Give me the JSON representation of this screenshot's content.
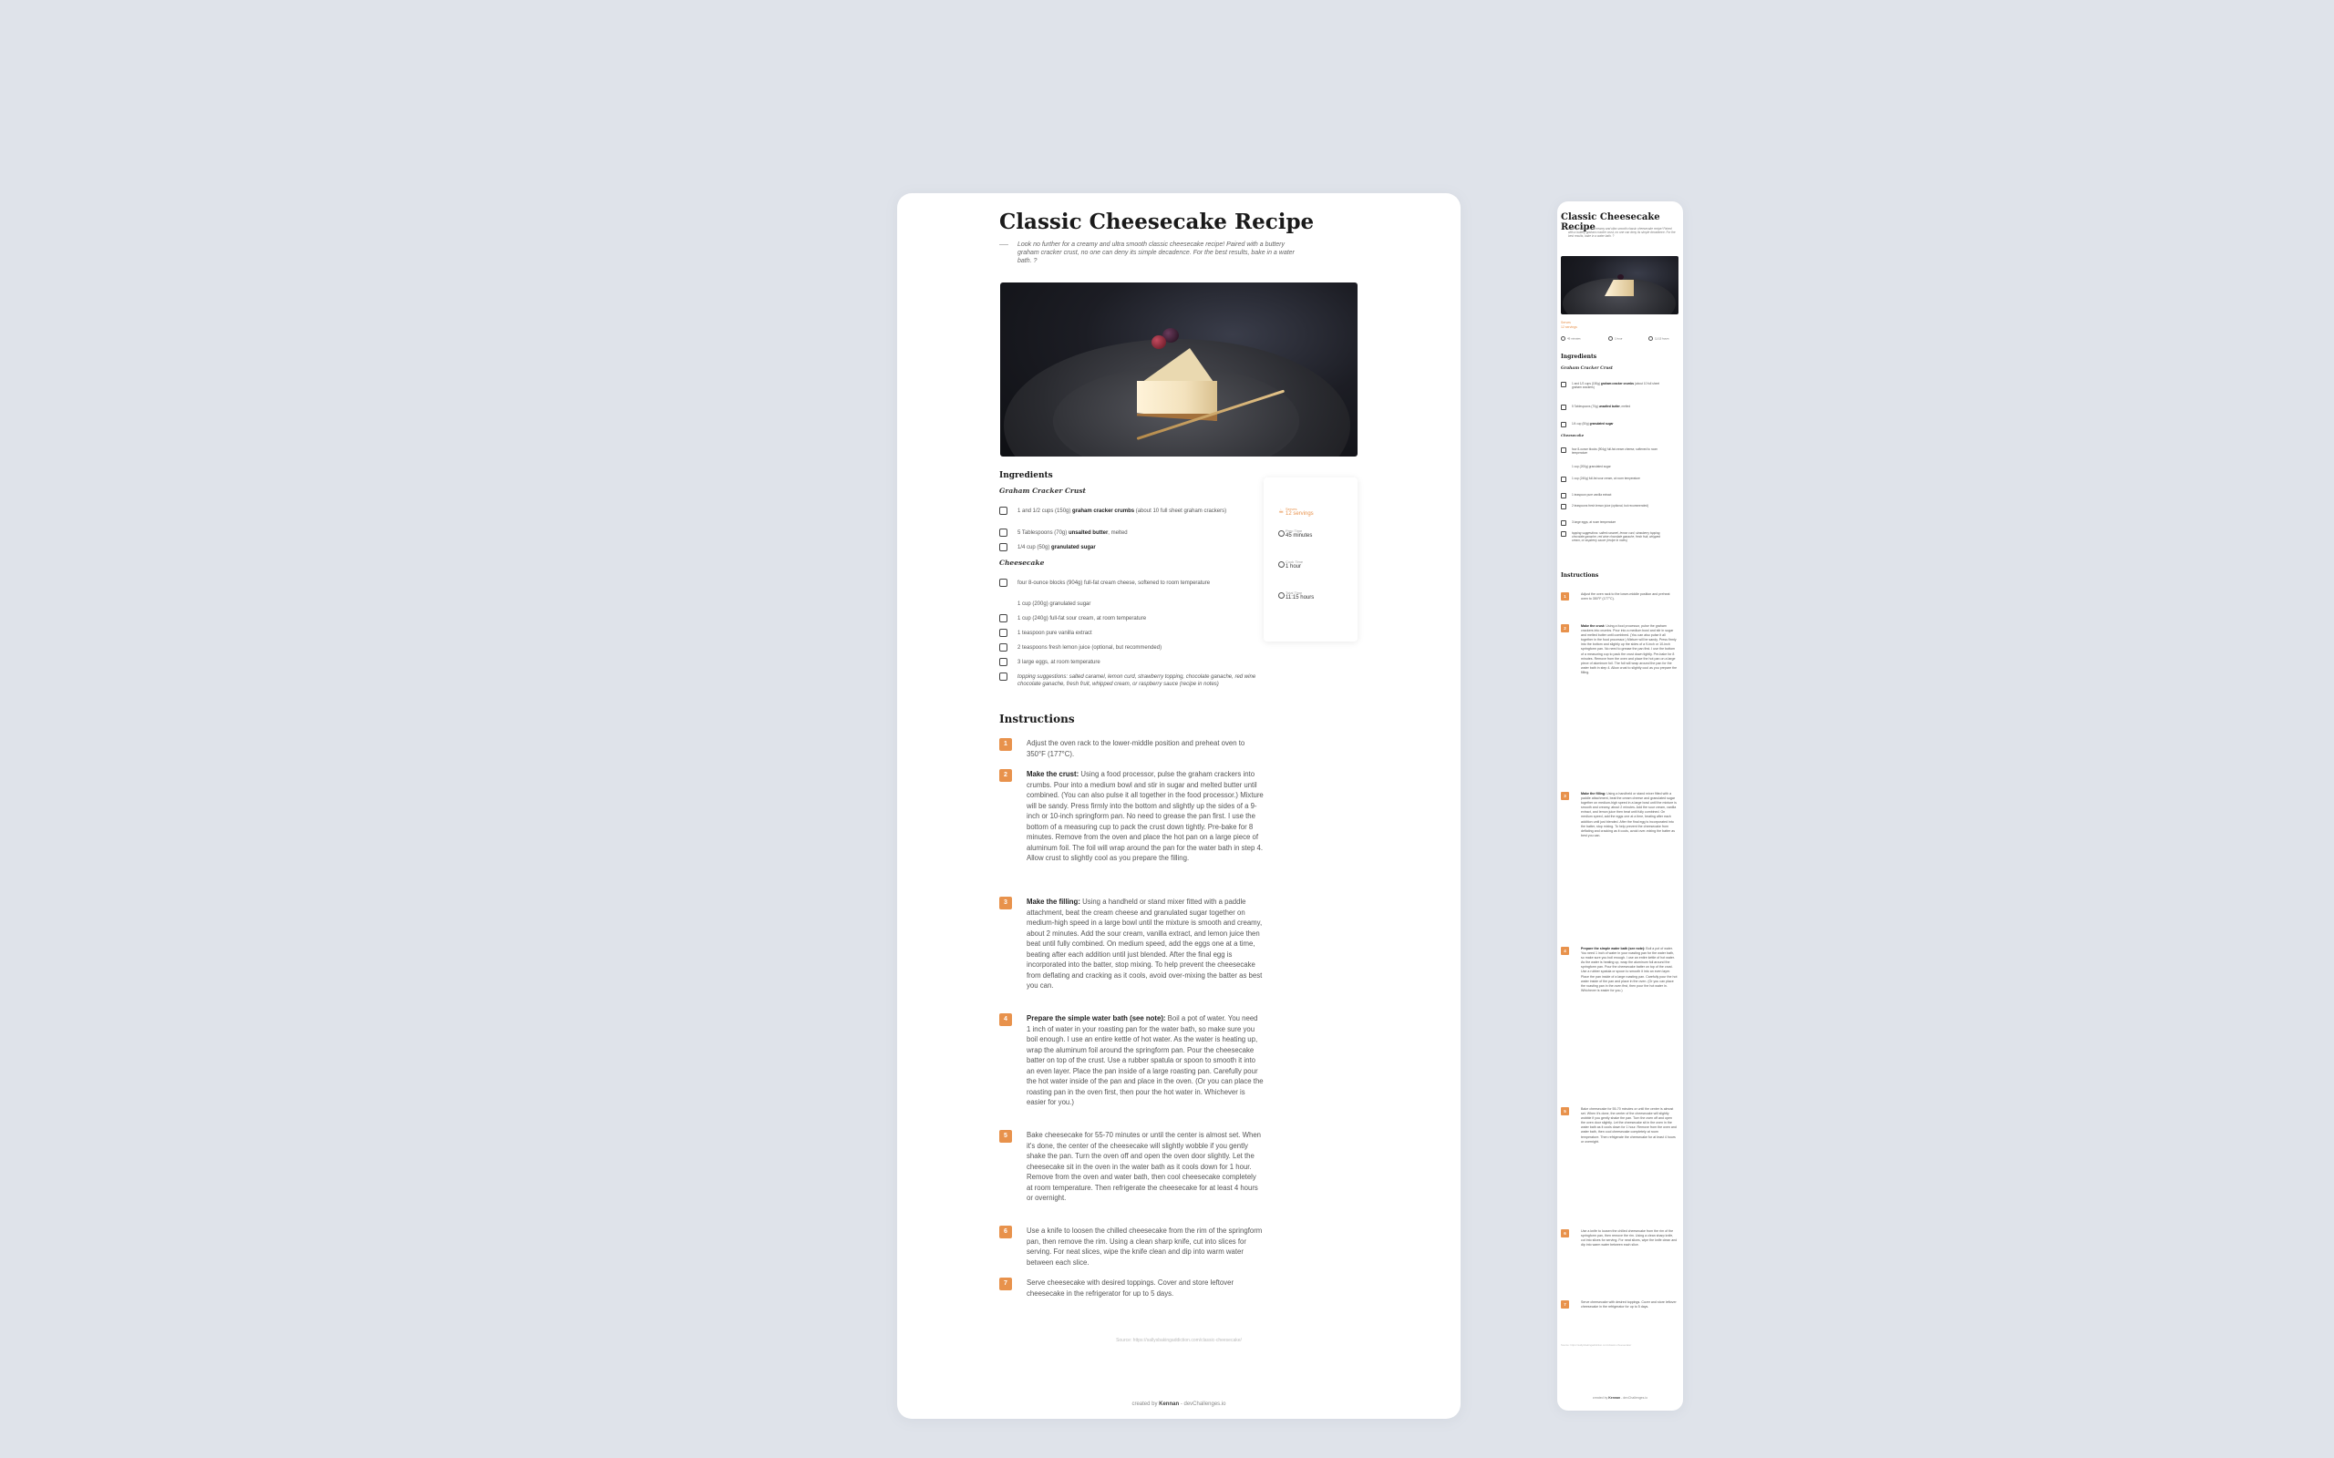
{
  "recipe": {
    "title": "Classic Cheesecake Recipe",
    "intro": "Look no further for a creamy and ultra smooth classic cheesecake recipe! Paired with a buttery graham cracker crust, no one can deny its simple decadence. For the best results, bake in a water bath. ?",
    "ingredients_heading": "Ingredients",
    "crust_heading": "Graham Cracker Crust",
    "crust_items": [
      {
        "pre": "1 and 1/2 cups (150g) ",
        "bold": "graham cracker crumbs",
        "post": " (about 10 full sheet graham crackers)"
      },
      {
        "pre": "5 Tablespoons (70g) ",
        "bold": "unsalted butter",
        "post": ", melted"
      },
      {
        "pre": "1/4 cup (50g) ",
        "bold": "granulated sugar",
        "post": ""
      }
    ],
    "cheesecake_heading": "Cheesecake",
    "cheesecake_items": [
      {
        "pre": "four 8-ounce blocks (904g) full-fat cream cheese, softened to room temperature",
        "bold": "",
        "post": ""
      },
      {
        "pre": "1 cup (200g) granulated sugar",
        "bold": "",
        "post": ""
      },
      {
        "pre": "1 cup (240g) full-fat sour cream, at room temperature",
        "bold": "",
        "post": ""
      },
      {
        "pre": "1 teaspoon pure vanilla extract",
        "bold": "",
        "post": ""
      },
      {
        "pre": "2 teaspoons fresh lemon juice (optional, but recommended)",
        "bold": "",
        "post": ""
      },
      {
        "pre": "3 large eggs, at room temperature",
        "bold": "",
        "post": ""
      },
      {
        "pre": "topping suggestions: salted caramel, lemon curd, strawberry topping, chocolate ganache, red wine chocolate ganache, fresh fruit, whipped cream, or raspberry sauce (recipe in notes)",
        "bold": "",
        "post": ""
      }
    ],
    "meta": {
      "serves_label": "Serves",
      "serves_value": "12 servings",
      "prep_label": "Prep Time",
      "prep_value": "45 minutes",
      "cook_label": "Cook Time",
      "cook_value": "1 hour",
      "total_label": "Total Time",
      "total_value": "11:15 hours"
    },
    "instructions_heading": "Instructions",
    "steps": [
      {
        "n": "1",
        "bold": "",
        "text": "Adjust the oven rack to the lower-middle position and preheat oven to 350°F (177°C)."
      },
      {
        "n": "2",
        "bold": "Make the crust:",
        "text": " Using a food processor, pulse the graham crackers into crumbs. Pour into a medium bowl and stir in sugar and melted butter until combined. (You can also pulse it all together in the food processor.) Mixture will be sandy. Press firmly into the bottom and slightly up the sides of a 9-inch or 10-inch springform pan. No need to grease the pan first. I use the bottom of a measuring cup to pack the crust down tightly. Pre-bake for 8 minutes. Remove from the oven and place the hot pan on a large piece of aluminum foil. The foil will wrap around the pan for the water bath in step 4. Allow crust to slightly cool as you prepare the filling."
      },
      {
        "n": "3",
        "bold": "Make the filling:",
        "text": " Using a handheld or stand mixer fitted with a paddle attachment, beat the cream cheese and granulated sugar together on medium-high speed in a large bowl until the mixture is smooth and creamy, about 2 minutes. Add the sour cream, vanilla extract, and lemon juice then beat until fully combined. On medium speed, add the eggs one at a time, beating after each addition until just blended. After the final egg is incorporated into the batter, stop mixing. To help prevent the cheesecake from deflating and cracking as it cools, avoid over-mixing the batter as best you can."
      },
      {
        "n": "4",
        "bold": "Prepare the simple water bath (see note):",
        "text": " Boil a pot of water. You need 1 inch of water in your roasting pan for the water bath, so make sure you boil enough. I use an entire kettle of hot water. As the water is heating up, wrap the aluminum foil around the springform pan. Pour the cheesecake batter on top of the crust. Use a rubber spatula or spoon to smooth it into an even layer. Place the pan inside of a large roasting pan. Carefully pour the hot water inside of the pan and place in the oven. (Or you can place the roasting pan in the oven first, then pour the hot water in. Whichever is easier for you.)"
      },
      {
        "n": "5",
        "bold": "",
        "text": "Bake cheesecake for 55-70 minutes or until the center is almost set. When it's done, the center of the cheesecake will slightly wobble if you gently shake the pan. Turn the oven off and open the oven door slightly. Let the cheesecake sit in the oven in the water bath as it cools down for 1 hour. Remove from the oven and water bath, then cool cheesecake completely at room temperature. Then refrigerate the cheesecake for at least 4 hours or overnight."
      },
      {
        "n": "6",
        "bold": "",
        "text": "Use a knife to loosen the chilled cheesecake from the rim of the springform pan, then remove the rim. Using a clean sharp knife, cut into slices for serving. For neat slices, wipe the knife clean and dip into warm water between each slice."
      },
      {
        "n": "7",
        "bold": "",
        "text": "Serve cheesecake with desired toppings. Cover and store leftover cheesecake in the refrigerator for up to 5 days."
      }
    ],
    "source": "Source: https://sallysbakingaddiction.com/classic-cheesecake/",
    "footer_pre": "created by ",
    "footer_author": "Kennan",
    "footer_post": " - devChallenges.io"
  },
  "colors": {
    "accent": "#e8924c",
    "page_bg": "#dfe3ea",
    "card_bg": "#ffffff"
  }
}
